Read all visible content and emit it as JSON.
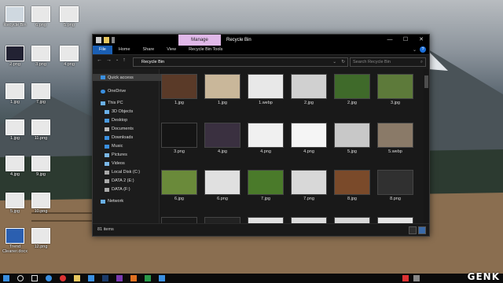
{
  "desktop": {
    "icons": [
      {
        "label": "Recycle Bin"
      },
      {
        "label": "6.png"
      },
      {
        "label": "5.png"
      },
      {
        "label": "2.png"
      },
      {
        "label": "3.png"
      },
      {
        "label": "4.png"
      },
      {
        "label": "1.jpg"
      },
      {
        "label": "7.jpg"
      },
      {
        "label": "1.jpg"
      },
      {
        "label": "11.png"
      },
      {
        "label": "4.jpg"
      },
      {
        "label": "9.jpg"
      },
      {
        "label": "5.jpg"
      },
      {
        "label": "10.png"
      },
      {
        "label": "Trend Cleaner.docx"
      },
      {
        "label": "12.png"
      }
    ],
    "watermark": "GENK"
  },
  "window": {
    "manage_tab": "Manage",
    "title": "Recycle Bin",
    "controls": {
      "minimize": "—",
      "maximize": "☐",
      "close": "✕"
    },
    "ribbon_tabs": [
      "File",
      "Home",
      "Share",
      "View",
      "Recycle Bin Tools"
    ],
    "help": "?",
    "address": "Recycle Bin",
    "search_placeholder": "Search Recycle Bin",
    "status": "81 items"
  },
  "nav_pane": [
    {
      "label": "Quick access"
    },
    {
      "label": "OneDrive"
    },
    {
      "label": "This PC"
    },
    {
      "label": "3D Objects"
    },
    {
      "label": "Desktop"
    },
    {
      "label": "Documents"
    },
    {
      "label": "Downloads"
    },
    {
      "label": "Music"
    },
    {
      "label": "Pictures"
    },
    {
      "label": "Videos"
    },
    {
      "label": "Local Disk (C:)"
    },
    {
      "label": "DATA 2 (E:)"
    },
    {
      "label": "DATA (F:)"
    },
    {
      "label": "Network"
    }
  ],
  "files": [
    {
      "name": "1.jpg",
      "color": "#5a3a28"
    },
    {
      "name": "1.jpg",
      "color": "#c9b79a"
    },
    {
      "name": "1.webp",
      "color": "#e8e8e8"
    },
    {
      "name": "2.jpg",
      "color": "#d0d0d0"
    },
    {
      "name": "2.jpg",
      "color": "#3f6a2a"
    },
    {
      "name": "3.jpg",
      "color": "#5d7a3a"
    },
    {
      "name": "3.png",
      "color": "#151515"
    },
    {
      "name": "4.jpg",
      "color": "#3a3040"
    },
    {
      "name": "4.png",
      "color": "#f0f0f0"
    },
    {
      "name": "4.png",
      "color": "#f5f5f5"
    },
    {
      "name": "5.jpg",
      "color": "#c8c8c8"
    },
    {
      "name": "5.webp",
      "color": "#8a7a68"
    },
    {
      "name": "6.jpg",
      "color": "#6a8a3a"
    },
    {
      "name": "6.png",
      "color": "#e0e0e0"
    },
    {
      "name": "7.jpg",
      "color": "#4a7a2a"
    },
    {
      "name": "7.png",
      "color": "#d8d8d8"
    },
    {
      "name": "8.jpg",
      "color": "#7a4a2a"
    },
    {
      "name": "8.png",
      "color": "#303030"
    },
    {
      "name": "",
      "color": "#1a1a1a"
    },
    {
      "name": "",
      "color": "#222222"
    },
    {
      "name": "",
      "color": "#e0e0e0"
    },
    {
      "name": "",
      "color": "#dcdcdc"
    },
    {
      "name": "",
      "color": "#d8d8d8"
    },
    {
      "name": "",
      "color": "#e4e4e4"
    }
  ]
}
